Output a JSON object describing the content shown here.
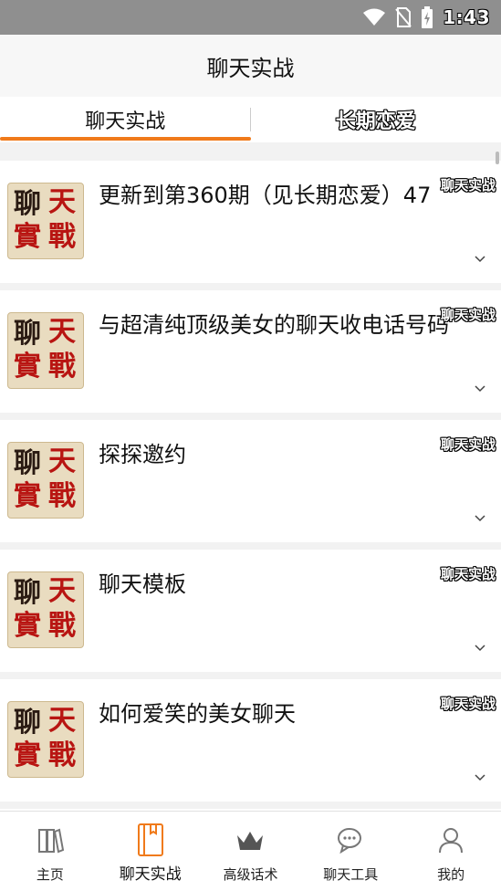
{
  "status_bar": {
    "time": "1:43",
    "icons": [
      "wifi-icon",
      "no-sim-icon",
      "battery-charging-icon"
    ]
  },
  "app_bar": {
    "title": "聊天实战"
  },
  "tabs": [
    {
      "label": "聊天实战",
      "active": true
    },
    {
      "label": "长期恋爱",
      "active": false
    }
  ],
  "thumbnail_text": [
    "聊",
    "天",
    "實",
    "戰"
  ],
  "items": [
    {
      "title": "更新到第360期（见长期恋爱）47",
      "tag": "聊天实战"
    },
    {
      "title": "与超清纯顶级美女的聊天收电话号码",
      "tag": "聊天实战"
    },
    {
      "title": "探探邀约",
      "tag": "聊天实战"
    },
    {
      "title": "聊天模板",
      "tag": "聊天实战"
    },
    {
      "title": "如何爱笑的美女聊天",
      "tag": "聊天实战"
    }
  ],
  "bottom_nav": [
    {
      "label": "主页",
      "icon": "books-icon",
      "active": false
    },
    {
      "label": "聊天实战",
      "icon": "notebook-icon",
      "active": true
    },
    {
      "label": "高级话术",
      "icon": "crown-icon",
      "active": false
    },
    {
      "label": "聊天工具",
      "icon": "chat-bubble-icon",
      "active": false
    },
    {
      "label": "我的",
      "icon": "user-icon",
      "active": false
    }
  ],
  "colors": {
    "accent": "#f07a1a",
    "status_bar": "#8f8f8f",
    "seal_red": "#b81512"
  }
}
